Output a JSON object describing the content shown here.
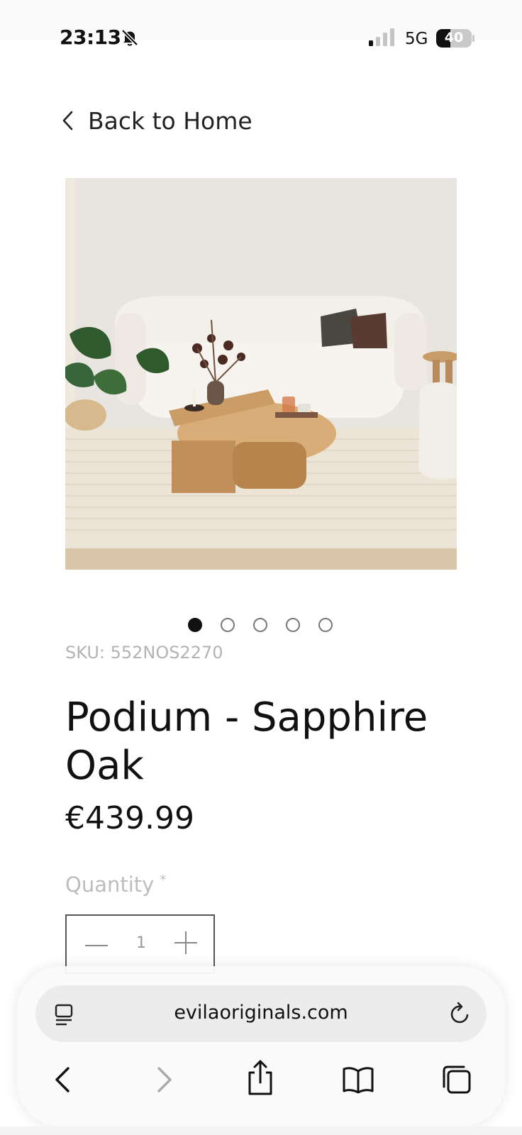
{
  "status_bar": {
    "time": "23:13",
    "network": "5G",
    "battery_percent": "40",
    "battery_level": 0.4,
    "icons": [
      "bell-slash-icon",
      "signal-icon"
    ]
  },
  "nav": {
    "back_label": "Back to Home",
    "icon": "chevron-left-icon"
  },
  "gallery": {
    "image_count": 5,
    "active_index": 0
  },
  "product": {
    "sku": "SKU: 552NOS2270",
    "title": "Podium - Sapphire Oak",
    "price": "€439.99"
  },
  "quantity": {
    "label": "Quantity",
    "required_mark": "*",
    "value": "1"
  },
  "browser": {
    "url": "evilaoriginals.com",
    "icons": [
      "reader-icon",
      "reload-icon",
      "back-icon",
      "forward-icon",
      "share-icon",
      "bookmarks-icon",
      "tabs-icon"
    ]
  },
  "colors": {
    "text": "#111111",
    "muted": "#b3b3b3",
    "toolbar_bg": "#fafafa"
  }
}
